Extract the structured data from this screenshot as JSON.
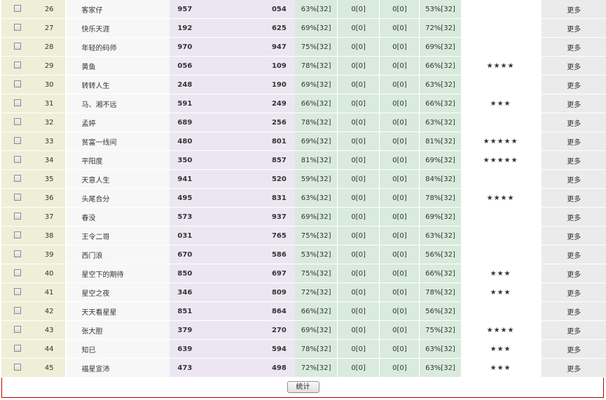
{
  "rows": [
    {
      "num": "26",
      "name": "客家仔",
      "v1": "957",
      "v2": "054",
      "g1": "63%[32]",
      "g2": "0[0]",
      "g3": "0[0]",
      "g4": "53%[32]",
      "stars": "",
      "more": "更多"
    },
    {
      "num": "27",
      "name": "快乐天涯",
      "v1": "192",
      "v2": "625",
      "g1": "69%[32]",
      "g2": "0[0]",
      "g3": "0[0]",
      "g4": "72%[32]",
      "stars": "",
      "more": "更多"
    },
    {
      "num": "28",
      "name": "年轻的码师",
      "v1": "970",
      "v2": "947",
      "g1": "75%[32]",
      "g2": "0[0]",
      "g3": "0[0]",
      "g4": "69%[32]",
      "stars": "",
      "more": "更多"
    },
    {
      "num": "29",
      "name": "黄鱼",
      "v1": "056",
      "v2": "109",
      "g1": "78%[32]",
      "g2": "0[0]",
      "g3": "0[0]",
      "g4": "66%[32]",
      "stars": "★★★★",
      "more": "更多"
    },
    {
      "num": "30",
      "name": "转转人生",
      "v1": "248",
      "v2": "190",
      "g1": "69%[32]",
      "g2": "0[0]",
      "g3": "0[0]",
      "g4": "63%[32]",
      "stars": "",
      "more": "更多"
    },
    {
      "num": "31",
      "name": "马、湘不远",
      "v1": "591",
      "v2": "249",
      "g1": "66%[32]",
      "g2": "0[0]",
      "g3": "0[0]",
      "g4": "66%[32]",
      "stars": "★★★",
      "more": "更多"
    },
    {
      "num": "32",
      "name": "孟婷",
      "v1": "689",
      "v2": "256",
      "g1": "78%[32]",
      "g2": "0[0]",
      "g3": "0[0]",
      "g4": "63%[32]",
      "stars": "",
      "more": "更多"
    },
    {
      "num": "33",
      "name": "贫富一线间",
      "v1": "480",
      "v2": "801",
      "g1": "69%[32]",
      "g2": "0[0]",
      "g3": "0[0]",
      "g4": "81%[32]",
      "stars": "★★★★★",
      "more": "更多"
    },
    {
      "num": "34",
      "name": "平阳度",
      "v1": "350",
      "v2": "857",
      "g1": "81%[32]",
      "g2": "0[0]",
      "g3": "0[0]",
      "g4": "69%[32]",
      "stars": "★★★★★",
      "more": "更多"
    },
    {
      "num": "35",
      "name": "天意人生",
      "v1": "941",
      "v2": "520",
      "g1": "59%[32]",
      "g2": "0[0]",
      "g3": "0[0]",
      "g4": "84%[32]",
      "stars": "",
      "more": "更多"
    },
    {
      "num": "36",
      "name": "头尾合分",
      "v1": "495",
      "v2": "831",
      "g1": "63%[32]",
      "g2": "0[0]",
      "g3": "0[0]",
      "g4": "78%[32]",
      "stars": "★★★★",
      "more": "更多"
    },
    {
      "num": "37",
      "name": "春没",
      "v1": "573",
      "v2": "937",
      "g1": "69%[32]",
      "g2": "0[0]",
      "g3": "0[0]",
      "g4": "69%[32]",
      "stars": "",
      "more": "更多"
    },
    {
      "num": "38",
      "name": "王令二哥",
      "v1": "031",
      "v2": "765",
      "g1": "75%[32]",
      "g2": "0[0]",
      "g3": "0[0]",
      "g4": "63%[32]",
      "stars": "",
      "more": "更多"
    },
    {
      "num": "39",
      "name": "西门浪",
      "v1": "670",
      "v2": "586",
      "g1": "53%[32]",
      "g2": "0[0]",
      "g3": "0[0]",
      "g4": "56%[32]",
      "stars": "",
      "more": "更多"
    },
    {
      "num": "40",
      "name": "星空下的期待",
      "v1": "850",
      "v2": "697",
      "g1": "75%[32]",
      "g2": "0[0]",
      "g3": "0[0]",
      "g4": "66%[32]",
      "stars": "★★★",
      "more": "更多"
    },
    {
      "num": "41",
      "name": "星空之夜",
      "v1": "346",
      "v2": "809",
      "g1": "72%[32]",
      "g2": "0[0]",
      "g3": "0[0]",
      "g4": "78%[32]",
      "stars": "★★★",
      "more": "更多"
    },
    {
      "num": "42",
      "name": "天天看星星",
      "v1": "851",
      "v2": "864",
      "g1": "66%[32]",
      "g2": "0[0]",
      "g3": "0[0]",
      "g4": "56%[32]",
      "stars": "",
      "more": "更多"
    },
    {
      "num": "43",
      "name": "张大胆",
      "v1": "379",
      "v2": "270",
      "g1": "69%[32]",
      "g2": "0[0]",
      "g3": "0[0]",
      "g4": "75%[32]",
      "stars": "★★★★",
      "more": "更多"
    },
    {
      "num": "44",
      "name": "知已",
      "v1": "639",
      "v2": "594",
      "g1": "78%[32]",
      "g2": "0[0]",
      "g3": "0[0]",
      "g4": "63%[32]",
      "stars": "★★★",
      "more": "更多"
    },
    {
      "num": "45",
      "name": "福星宣沛",
      "v1": "473",
      "v2": "498",
      "g1": "72%[32]",
      "g2": "0[0]",
      "g3": "0[0]",
      "g4": "63%[32]",
      "stars": "★★★",
      "more": "更多"
    }
  ],
  "footer": {
    "stat_button": "统计"
  }
}
